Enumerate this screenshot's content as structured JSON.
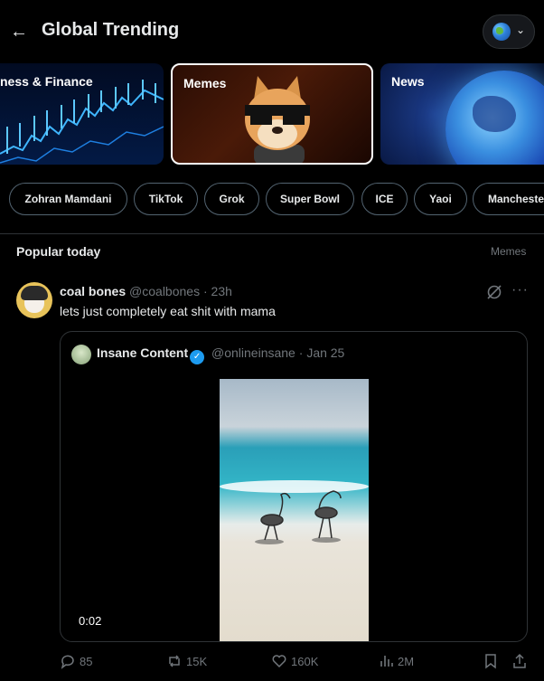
{
  "header": {
    "title": "Global Trending"
  },
  "cards": [
    {
      "label": "ness & Finance"
    },
    {
      "label": "Memes"
    },
    {
      "label": "News"
    }
  ],
  "chips": [
    "Zohran Mamdani",
    "TikTok",
    "Grok",
    "Super Bowl",
    "ICE",
    "Yaoi",
    "Mancheste"
  ],
  "section": {
    "title": "Popular today",
    "tag": "Memes"
  },
  "post": {
    "name": "coal bones",
    "handle": "@coalbones",
    "sep": "·",
    "time": "23h",
    "text": "lets just completely eat shit with mama",
    "quote": {
      "name": "Insane Content",
      "handle": "@onlineinsane",
      "sep": "·",
      "date": "Jan 25",
      "timecode": "0:02"
    },
    "actions": {
      "replies": "85",
      "reposts": "15K",
      "likes": "160K",
      "views": "2M"
    }
  },
  "colors": {
    "background": "#000000",
    "text": "#e7e9ea",
    "muted": "#71767b",
    "border": "#2f3336",
    "verified": "#1d9bf0"
  }
}
